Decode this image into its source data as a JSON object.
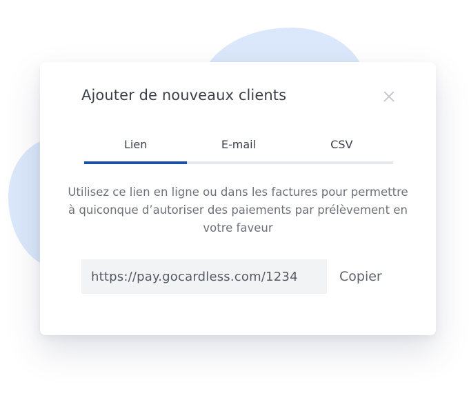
{
  "modal": {
    "title": "Ajouter de nouveaux clients",
    "close_icon": "close-icon"
  },
  "tabs": [
    {
      "label": "Lien",
      "active": true
    },
    {
      "label": "E-mail",
      "active": false
    },
    {
      "label": "CSV",
      "active": false
    }
  ],
  "description": "Utilisez ce lien en ligne ou dans les factures pour permettre à quiconque d’autoriser des paiements par prélèvement en votre faveur",
  "link": {
    "value": "https://pay.gocardless.com/1234",
    "copy_label": "Copier"
  },
  "colors": {
    "accent": "#1b4fa8",
    "blob": "#dbe8fb",
    "field_bg": "#f2f3f5"
  }
}
